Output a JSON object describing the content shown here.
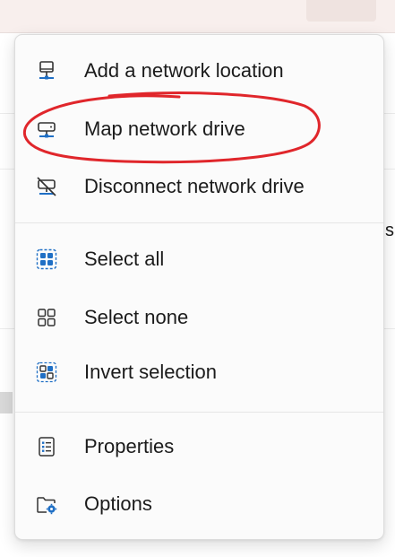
{
  "context_menu": {
    "items": [
      {
        "label": "Add a network location",
        "icon": "network-location-icon"
      },
      {
        "label": "Map network drive",
        "icon": "map-drive-icon"
      },
      {
        "label": "Disconnect network drive",
        "icon": "disconnect-drive-icon"
      },
      {
        "label": "Select all",
        "icon": "select-all-icon"
      },
      {
        "label": "Select none",
        "icon": "select-none-icon"
      },
      {
        "label": "Invert selection",
        "icon": "invert-selection-icon"
      },
      {
        "label": "Properties",
        "icon": "properties-icon"
      },
      {
        "label": "Options",
        "icon": "options-icon"
      }
    ]
  },
  "background": {
    "partial_text": "s"
  },
  "colors": {
    "accent_blue": "#1f6fc5",
    "annotation_red": "#e0262b",
    "text": "#1b1b1b"
  }
}
